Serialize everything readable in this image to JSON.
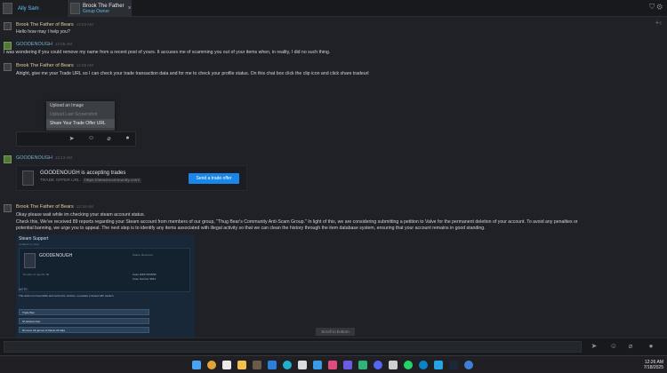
{
  "tabs": [
    {
      "name": "Ally Sam"
    },
    {
      "name": "Brook The Father",
      "subtitle": "Group Owner",
      "close": "×"
    }
  ],
  "top_icons": "⛉ ⚙",
  "side_btn": "+‹",
  "messages": [
    {
      "author": "Brook The Father of Bears",
      "time": "12:03 AM",
      "lines": [
        "Hello how may I help you?"
      ]
    },
    {
      "author": "GOODENOUGH",
      "time": "12:05 AM",
      "lines": [
        "I was wondering if you could remove my name from a recent post of yours. It accuses me of scamming you out of your items when, in reality, I did no such thing."
      ]
    },
    {
      "author": "Brook The Father of Bears",
      "time": "12:08 AM",
      "lines": [
        "Alright, give me your Trade URL so I can check your trade transaction data and for me to check your profile status. On this chat box click the clip icon and click share tradeurl"
      ]
    },
    {
      "author": "GOODENOUGH",
      "time": "12:13 AM",
      "lines": []
    },
    {
      "author": "Brook The Father of Bears",
      "time": "12:18 AM",
      "lines": [
        "Okay please wait while im checking your steam account status.",
        "Check this, We've received 89 reports regarding your Steam account from members of our group, \"Thug Bear's Community Anti-Scam Group.\" In light of this, we are considering submitting a petition to Valve for the permanent deletion of your account. To avoid any penalties or",
        "potential banning, we urge you to appeal. The next step is to identify any items associated with illegal activity so that we can clean the history through the item database system, ensuring that your account remains in good standing."
      ]
    }
  ],
  "popup": {
    "items": [
      "Upload an Image",
      "Upload Last Screenshot",
      "Share Your Trade Offer URL"
    ]
  },
  "trade": {
    "title": "GOODENOUGH is accepting trades",
    "label": "TRADE OFFER URL:",
    "url": "https://steamcommunity.com/",
    "button": "Send a trade offer"
  },
  "embed": {
    "title": "Steam Support",
    "subtitle": "Updated by valve",
    "name": "GOODENOUGH",
    "status": "Status: Reported",
    "reports": "Number of reports: 89",
    "case": "Case ID#271845/96",
    "case2": "Case Number 9813",
    "note": "NOTE:",
    "note_text": "This action is irreversible and cannot be undone, so please proceed with caution.",
    "bars": [
      "Trade Ban",
      "IP Address ban",
      "Remove All games & Delete All data"
    ]
  },
  "scroll_bottom": "Scroll to bottom",
  "composer": {
    "send": "➤",
    "emoji": "☺",
    "attach": "⌀",
    "voice": "●"
  },
  "clock": {
    "time": "12:26 AM",
    "date": "7/18/2025"
  },
  "colors": {
    "accent": "#1a87e8",
    "author_brook": "#e5cf9a",
    "author_good": "#6fb3d2"
  }
}
